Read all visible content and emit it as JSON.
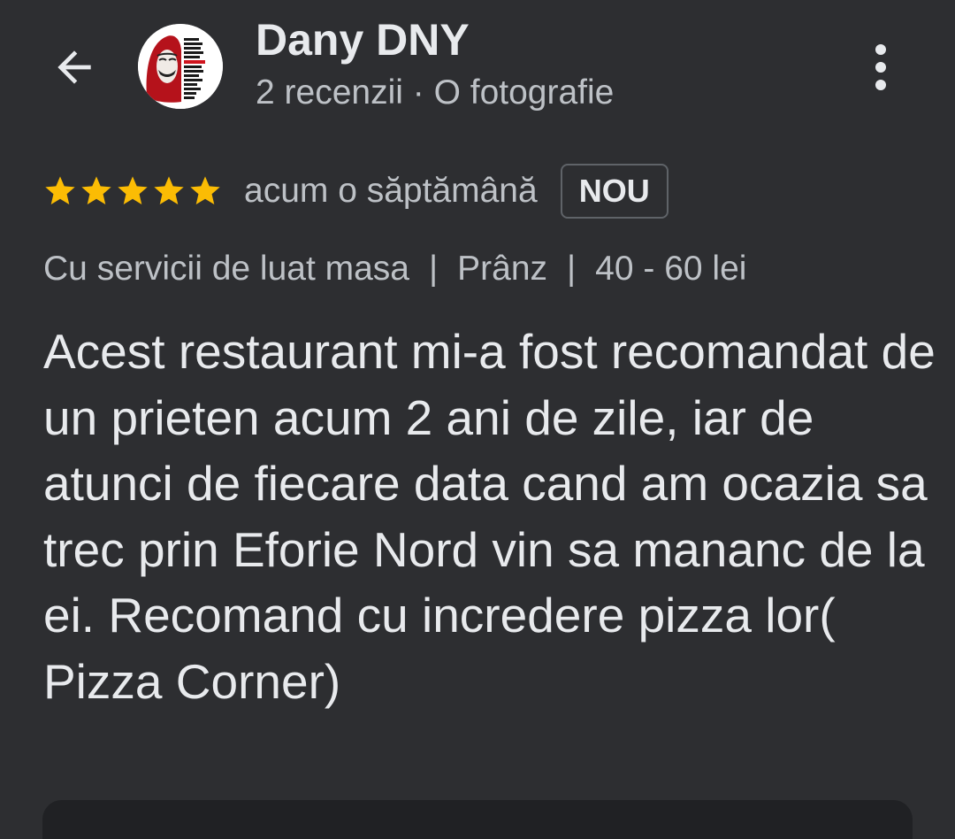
{
  "header": {
    "back_icon": "arrow-left-icon",
    "avatar_icon": "profile-avatar-icon",
    "reviewer_name": "Dany DNY",
    "reviewer_meta": "2 recenzii · O fotografie",
    "menu_icon": "more-vertical-icon"
  },
  "review": {
    "rating": 5,
    "max_rating": 5,
    "star_color": "#fbbc04",
    "time_ago": "acum o săptămână",
    "badge": "NOU",
    "details": {
      "service": "Cu servicii de luat masa",
      "meal": "Prânz",
      "price": "40 - 60 lei",
      "separator": "|"
    },
    "text": "Acest restaurant mi-a fost recomandat de un prieten acum 2 ani de zile, iar de atunci de fiecare data cand am ocazia sa trec prin Eforie Nord vin sa mananc de la ei. Recomand cu incredere pizza lor( Pizza Corner)"
  },
  "colors": {
    "background": "#2d2e31",
    "primary_text": "#e8eaed",
    "secondary_text": "#bdc1c6",
    "badge_border": "#5f6368",
    "photo_card": "#202124"
  }
}
